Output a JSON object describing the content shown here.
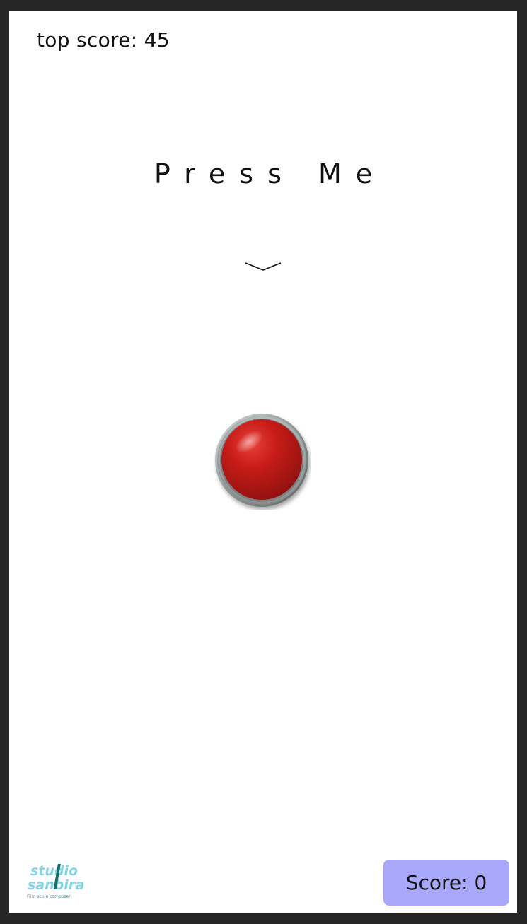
{
  "game": {
    "top_score_label": "top score: 45",
    "title": "Press Me",
    "score_label": "Score: 0"
  },
  "logo": {
    "line1": "studio",
    "line2": "sanbira",
    "tagline": "Film score composer"
  },
  "icons": {
    "hint": "chevron-down-icon",
    "button": "red-button-icon"
  },
  "colors": {
    "frame_bg": "#262626",
    "page_bg": "#ffffff",
    "button_red": "#c0181a",
    "score_bg": "#a8a8fb",
    "logo_cyan": "#7fd0e0",
    "logo_teal": "#157070"
  }
}
